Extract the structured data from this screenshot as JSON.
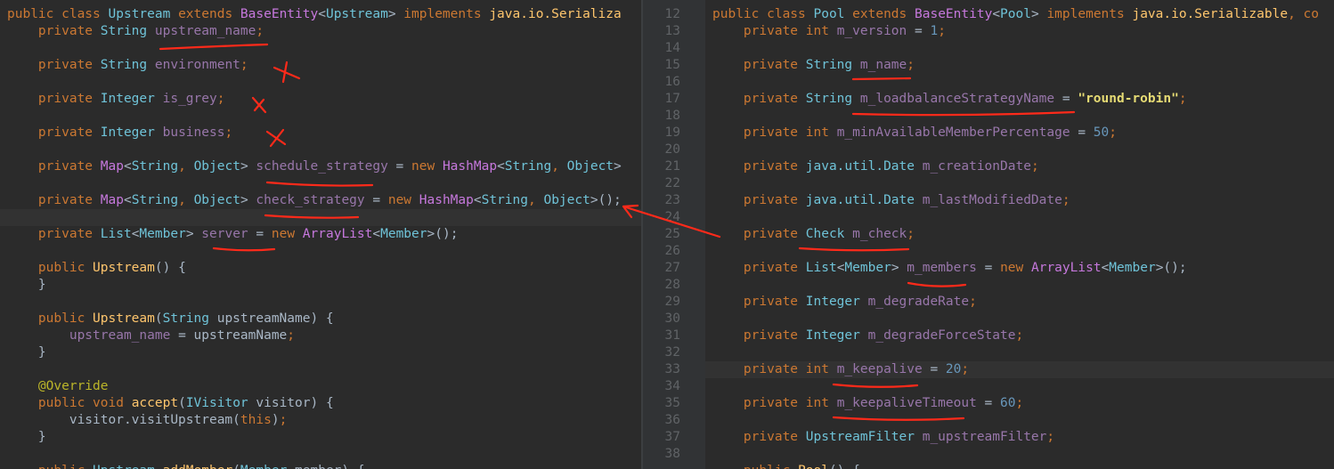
{
  "left": {
    "lines": [
      [
        [
          "kw",
          "public class "
        ],
        [
          "ty",
          "Upstream "
        ],
        [
          "kw",
          "extends "
        ],
        [
          "cls",
          "BaseEntity"
        ],
        [
          "plain",
          "<"
        ],
        [
          "ty",
          "Upstream"
        ],
        [
          "plain",
          "> "
        ],
        [
          "kw",
          "implements "
        ],
        [
          "fn",
          "java.io.Serializa"
        ]
      ],
      [
        [
          "kw",
          "    private "
        ],
        [
          "ty",
          "String "
        ],
        [
          "fld",
          "upstream_name"
        ],
        [
          "kw",
          ";"
        ]
      ],
      [],
      [
        [
          "kw",
          "    private "
        ],
        [
          "ty",
          "String "
        ],
        [
          "fld",
          "environment"
        ],
        [
          "kw",
          ";"
        ]
      ],
      [],
      [
        [
          "kw",
          "    private "
        ],
        [
          "ty",
          "Integer "
        ],
        [
          "fld",
          "is_grey"
        ],
        [
          "kw",
          ";"
        ]
      ],
      [],
      [
        [
          "kw",
          "    private "
        ],
        [
          "ty",
          "Integer "
        ],
        [
          "fld",
          "business"
        ],
        [
          "kw",
          ";"
        ]
      ],
      [],
      [
        [
          "kw",
          "    private "
        ],
        [
          "cls",
          "Map"
        ],
        [
          "plain",
          "<"
        ],
        [
          "ty",
          "String"
        ],
        [
          "kw",
          ", "
        ],
        [
          "ty",
          "Object"
        ],
        [
          "plain",
          "> "
        ],
        [
          "fld",
          "schedule_strategy"
        ],
        [
          "plain",
          " = "
        ],
        [
          "kw",
          "new "
        ],
        [
          "cls",
          "HashMap"
        ],
        [
          "plain",
          "<"
        ],
        [
          "ty",
          "String"
        ],
        [
          "kw",
          ", "
        ],
        [
          "ty",
          "Object"
        ],
        [
          "plain",
          ">"
        ]
      ],
      [],
      [
        [
          "kw",
          "    private "
        ],
        [
          "cls",
          "Map"
        ],
        [
          "plain",
          "<"
        ],
        [
          "ty",
          "String"
        ],
        [
          "kw",
          ", "
        ],
        [
          "ty",
          "Object"
        ],
        [
          "plain",
          "> "
        ],
        [
          "fld",
          "check_strategy"
        ],
        [
          "plain",
          " = "
        ],
        [
          "kw",
          "new "
        ],
        [
          "cls",
          "HashMap"
        ],
        [
          "plain",
          "<"
        ],
        [
          "ty",
          "String"
        ],
        [
          "kw",
          ", "
        ],
        [
          "ty",
          "Object"
        ],
        [
          "plain",
          ">();"
        ]
      ],
      [],
      [
        [
          "kw",
          "    private "
        ],
        [
          "ty",
          "List"
        ],
        [
          "plain",
          "<"
        ],
        [
          "ty",
          "Member"
        ],
        [
          "plain",
          "> "
        ],
        [
          "fld",
          "server"
        ],
        [
          "plain",
          " = "
        ],
        [
          "kw",
          "new "
        ],
        [
          "cls",
          "ArrayList"
        ],
        [
          "plain",
          "<"
        ],
        [
          "ty",
          "Member"
        ],
        [
          "plain",
          ">();"
        ]
      ],
      [],
      [
        [
          "kw",
          "    public "
        ],
        [
          "fn",
          "Upstream"
        ],
        [
          "plain",
          "() {"
        ]
      ],
      [
        [
          "plain",
          "    }"
        ]
      ],
      [],
      [
        [
          "kw",
          "    public "
        ],
        [
          "fn",
          "Upstream"
        ],
        [
          "plain",
          "("
        ],
        [
          "ty",
          "String "
        ],
        [
          "plain",
          "upstreamName) {"
        ]
      ],
      [
        [
          "plain",
          "        "
        ],
        [
          "fld",
          "upstream_name"
        ],
        [
          "plain",
          " = upstreamName"
        ],
        [
          "kw",
          ";"
        ]
      ],
      [
        [
          "plain",
          "    }"
        ]
      ],
      [],
      [
        [
          "ann",
          "    @Override"
        ]
      ],
      [
        [
          "kw",
          "    public void "
        ],
        [
          "fn",
          "accept"
        ],
        [
          "plain",
          "("
        ],
        [
          "ty",
          "IVisitor "
        ],
        [
          "plain",
          "visitor) {"
        ]
      ],
      [
        [
          "plain",
          "        visitor.visitUpstream("
        ],
        [
          "this",
          "this"
        ],
        [
          "plain",
          ")"
        ],
        [
          "kw",
          ";"
        ]
      ],
      [
        [
          "plain",
          "    }"
        ]
      ],
      [],
      [
        [
          "kw",
          "    public "
        ],
        [
          "ty",
          "Upstream "
        ],
        [
          "fn",
          "addMember"
        ],
        [
          "plain",
          "("
        ],
        [
          "ty",
          "Member "
        ],
        [
          "plain",
          "member) {"
        ]
      ]
    ]
  },
  "right": {
    "line_numbers": [
      "12",
      "13",
      "14",
      "15",
      "16",
      "17",
      "18",
      "19",
      "20",
      "21",
      "22",
      "23",
      "24",
      "25",
      "26",
      "27",
      "28",
      "29",
      "30",
      "31",
      "32",
      "33",
      "34",
      "35",
      "36",
      "37",
      "38"
    ],
    "lines": [
      [
        [
          "kw",
          "public class "
        ],
        [
          "ty",
          "Pool "
        ],
        [
          "kw",
          "extends "
        ],
        [
          "cls",
          "BaseEntity"
        ],
        [
          "plain",
          "<"
        ],
        [
          "ty",
          "Pool"
        ],
        [
          "plain",
          "> "
        ],
        [
          "kw",
          "implements "
        ],
        [
          "fn",
          "java.io.Serializable"
        ],
        [
          "kw",
          ", co"
        ]
      ],
      [
        [
          "kw",
          "    private int "
        ],
        [
          "fld",
          "m_version"
        ],
        [
          "plain",
          " = "
        ],
        [
          "num",
          "1"
        ],
        [
          "kw",
          ";"
        ]
      ],
      [],
      [
        [
          "kw",
          "    private "
        ],
        [
          "ty",
          "String "
        ],
        [
          "fld",
          "m_name"
        ],
        [
          "kw",
          ";"
        ]
      ],
      [],
      [
        [
          "kw",
          "    private "
        ],
        [
          "ty",
          "String "
        ],
        [
          "fld",
          "m_loadbalanceStrategyName"
        ],
        [
          "plain",
          " = "
        ],
        [
          "str",
          "\"round-robin\""
        ],
        [
          "kw",
          ";"
        ]
      ],
      [],
      [
        [
          "kw",
          "    private int "
        ],
        [
          "fld",
          "m_minAvailableMemberPercentage"
        ],
        [
          "plain",
          " = "
        ],
        [
          "num",
          "50"
        ],
        [
          "kw",
          ";"
        ]
      ],
      [],
      [
        [
          "kw",
          "    private "
        ],
        [
          "ty",
          "java.util.Date "
        ],
        [
          "fld",
          "m_creationDate"
        ],
        [
          "kw",
          ";"
        ]
      ],
      [],
      [
        [
          "kw",
          "    private "
        ],
        [
          "ty",
          "java.util.Date "
        ],
        [
          "fld",
          "m_lastModifiedDate"
        ],
        [
          "kw",
          ";"
        ]
      ],
      [],
      [
        [
          "kw",
          "    private "
        ],
        [
          "ty",
          "Check "
        ],
        [
          "fld",
          "m_check"
        ],
        [
          "kw",
          ";"
        ]
      ],
      [],
      [
        [
          "kw",
          "    private "
        ],
        [
          "ty",
          "List"
        ],
        [
          "plain",
          "<"
        ],
        [
          "ty",
          "Member"
        ],
        [
          "plain",
          "> "
        ],
        [
          "fld",
          "m_members"
        ],
        [
          "plain",
          " = "
        ],
        [
          "kw",
          "new "
        ],
        [
          "cls",
          "ArrayList"
        ],
        [
          "plain",
          "<"
        ],
        [
          "ty",
          "Member"
        ],
        [
          "plain",
          ">();"
        ]
      ],
      [],
      [
        [
          "kw",
          "    private "
        ],
        [
          "ty",
          "Integer "
        ],
        [
          "fld",
          "m_degradeRate"
        ],
        [
          "kw",
          ";"
        ]
      ],
      [],
      [
        [
          "kw",
          "    private "
        ],
        [
          "ty",
          "Integer "
        ],
        [
          "fld",
          "m_degradeForceState"
        ],
        [
          "kw",
          ";"
        ]
      ],
      [],
      [
        [
          "kw",
          "    private int "
        ],
        [
          "fld",
          "m_keepalive"
        ],
        [
          "plain",
          " = "
        ],
        [
          "num",
          "20"
        ],
        [
          "kw",
          ";"
        ]
      ],
      [],
      [
        [
          "kw",
          "    private int "
        ],
        [
          "fld",
          "m_keepaliveTimeout"
        ],
        [
          "plain",
          " = "
        ],
        [
          "num",
          "60"
        ],
        [
          "kw",
          ";"
        ]
      ],
      [],
      [
        [
          "kw",
          "    private "
        ],
        [
          "ty",
          "UpstreamFilter "
        ],
        [
          "fld",
          "m_upstreamFilter"
        ],
        [
          "kw",
          ";"
        ]
      ],
      [],
      [
        [
          "kw",
          "    public "
        ],
        [
          "fn",
          "Pool"
        ],
        [
          "plain",
          "() {"
        ]
      ]
    ]
  },
  "colors": {
    "background": "#2b2b2b",
    "keyword": "#cc7832",
    "type": "#6fc3d8",
    "field": "#9876aa",
    "function": "#ffc66d",
    "annotation_ink": "#ff2a1a"
  }
}
